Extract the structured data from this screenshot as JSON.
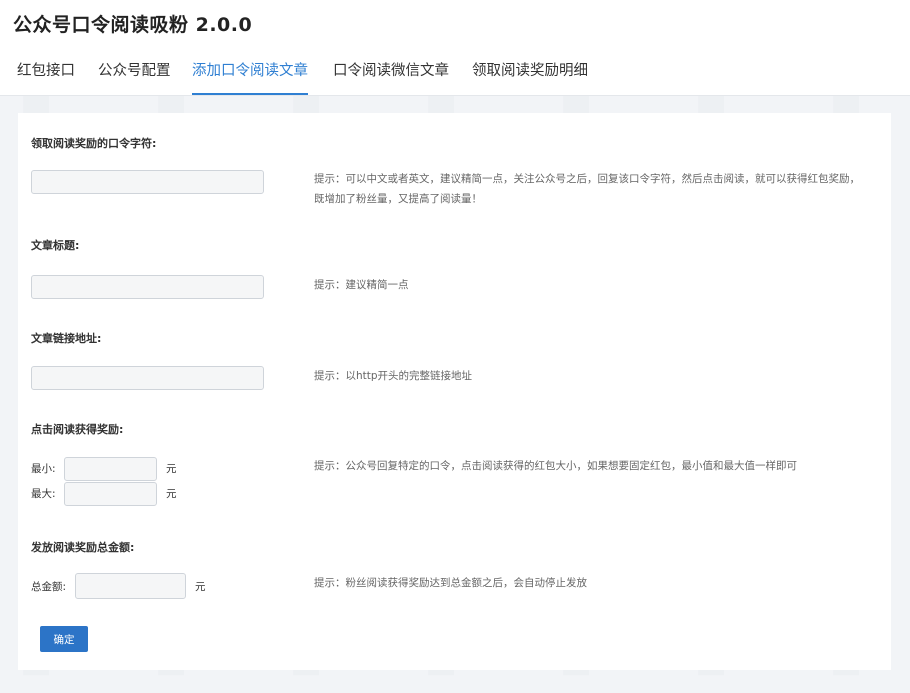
{
  "app": {
    "title": "公众号口令阅读吸粉 2.0.0"
  },
  "tabs": [
    {
      "label": "红包接口",
      "active": false
    },
    {
      "label": "公众号配置",
      "active": false
    },
    {
      "label": "添加口令阅读文章",
      "active": true
    },
    {
      "label": "口令阅读微信文章",
      "active": false
    },
    {
      "label": "领取阅读奖励明细",
      "active": false
    }
  ],
  "form": {
    "keyword": {
      "title": "领取阅读奖励的口令字符:",
      "value": "",
      "hint_line1": "提示：可以中文或者英文，建议精简一点，关注公众号之后，回复该口令字符，然后点击阅读，就可以获得红包奖励，",
      "hint_line2": "既增加了粉丝量，又提高了阅读量！"
    },
    "article_title": {
      "title": "文章标题:",
      "value": "",
      "hint": "提示：建议精简一点"
    },
    "article_url": {
      "title": "文章链接地址:",
      "value": "",
      "hint": "提示：以http开头的完整链接地址"
    },
    "reward": {
      "title": "点击阅读获得奖励:",
      "min_label": "最小:",
      "max_label": "最大:",
      "min_value": "",
      "max_value": "",
      "unit": "元",
      "hint": "提示：公众号回复特定的口令，点击阅读获得的红包大小，如果想要固定红包，最小值和最大值一样即可"
    },
    "total": {
      "title": "发放阅读奖励总金额:",
      "label": "总金额:",
      "value": "",
      "unit": "元",
      "hint": "提示：粉丝阅读获得奖励达到总金额之后，会自动停止发放"
    },
    "submit_label": "确定"
  },
  "colors": {
    "accent": "#2f7fd2",
    "button": "#2c74c7"
  }
}
